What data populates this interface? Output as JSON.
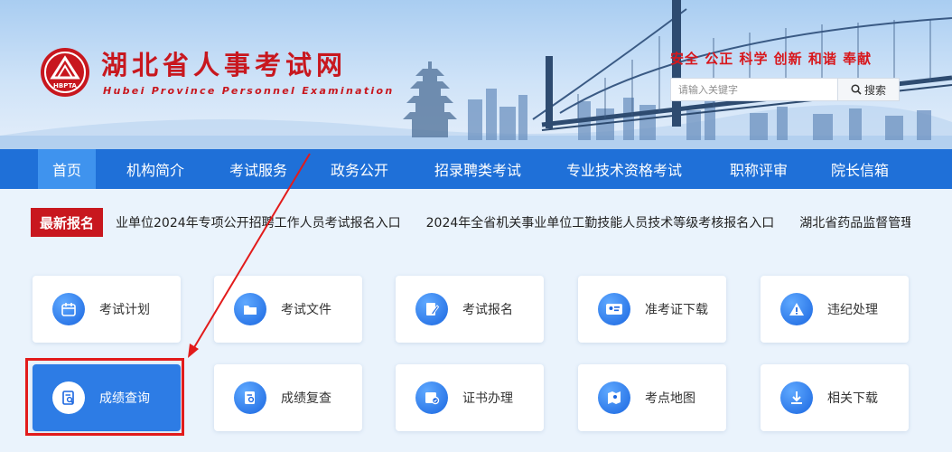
{
  "header": {
    "logo_text": "HBPTA",
    "title": "湖北省人事考试网",
    "subtitle": "Hubei Province Personnel Examination",
    "slogan": "安全 公正 科学 创新 和谐 奉献",
    "search": {
      "placeholder": "请输入关键字",
      "button_label": "搜索"
    }
  },
  "nav": {
    "items": [
      {
        "label": "首页",
        "active": true
      },
      {
        "label": "机构简介"
      },
      {
        "label": "考试服务"
      },
      {
        "label": "政务公开"
      },
      {
        "label": "招录聘类考试"
      },
      {
        "label": "专业技术资格考试"
      },
      {
        "label": "职称评审"
      },
      {
        "label": "院长信箱"
      }
    ]
  },
  "ticker": {
    "badge": "最新报名",
    "items": [
      "业单位2024年专项公开招聘工作人员考试报名入口",
      "2024年全省机关事业单位工勤技能人员技术等级考核报名入口",
      "湖北省药品监督管理局"
    ]
  },
  "cards": [
    {
      "label": "考试计划",
      "icon": "calendar-icon"
    },
    {
      "label": "考试文件",
      "icon": "folder-icon"
    },
    {
      "label": "考试报名",
      "icon": "edit-document-icon"
    },
    {
      "label": "准考证下载",
      "icon": "id-card-icon"
    },
    {
      "label": "违纪处理",
      "icon": "warning-icon"
    },
    {
      "label": "成绩查询",
      "icon": "search-document-icon",
      "active": true
    },
    {
      "label": "成绩复查",
      "icon": "review-document-icon"
    },
    {
      "label": "证书办理",
      "icon": "certificate-icon"
    },
    {
      "label": "考点地图",
      "icon": "map-pin-icon"
    },
    {
      "label": "相关下载",
      "icon": "download-icon"
    }
  ],
  "colors": {
    "brand_red": "#c8171e",
    "nav_blue": "#1f70d8",
    "nav_active": "#3f93ee",
    "card_active": "#2d7ce5"
  }
}
